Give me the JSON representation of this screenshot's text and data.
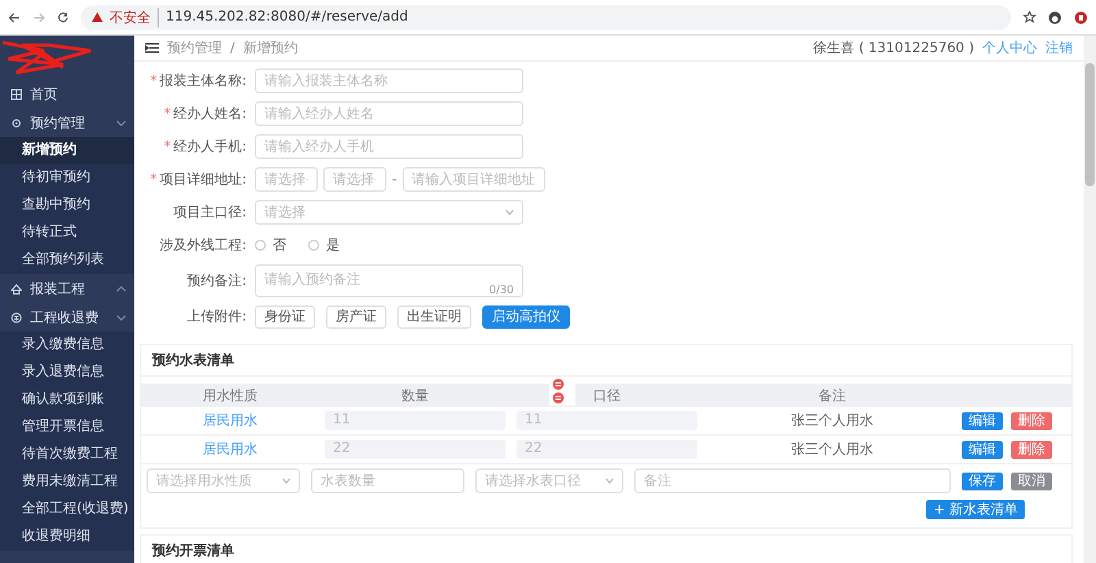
{
  "browser": {
    "warning": "不安全",
    "url": "119.45.202.82:8080/#/reserve/add"
  },
  "sidebar": {
    "items": [
      {
        "label": "首页",
        "selected": false
      },
      {
        "label": "预约管理",
        "expanded": true,
        "selected": false,
        "children": [
          {
            "label": "新增预约",
            "selected": true
          },
          {
            "label": "待初审预约",
            "selected": false
          },
          {
            "label": "查勘中预约",
            "selected": false
          },
          {
            "label": "待转正式",
            "selected": false
          },
          {
            "label": "全部预约列表",
            "selected": false
          }
        ]
      },
      {
        "label": "报装工程",
        "expanded": false,
        "selected": false
      },
      {
        "label": "工程收退费",
        "expanded": true,
        "selected": false,
        "children": [
          {
            "label": "录入缴费信息",
            "selected": false
          },
          {
            "label": "录入退费信息",
            "selected": false
          },
          {
            "label": "确认款项到账",
            "selected": false
          },
          {
            "label": "管理开票信息",
            "selected": false
          },
          {
            "label": "待首次缴费工程",
            "selected": false
          },
          {
            "label": "费用未缴清工程",
            "selected": false
          },
          {
            "label": "全部工程(收退费)",
            "selected": false
          },
          {
            "label": "收退费明细",
            "selected": false
          }
        ]
      }
    ]
  },
  "header": {
    "breadcrumb": [
      "预约管理",
      "新增预约"
    ],
    "breadcrumb_separator": "/",
    "user": "徐生喜 ( 13101225760 )",
    "links": [
      "个人中心",
      "注销"
    ]
  },
  "form": {
    "fields": [
      {
        "kind": "text",
        "mark": "*",
        "label": "报装主体名称:",
        "placeholder": "请输入报装主体名称"
      },
      {
        "kind": "text",
        "mark": "*",
        "label": "经办人姓名:",
        "placeholder": "请输入经办人姓名"
      },
      {
        "kind": "text",
        "mark": "*",
        "label": "经办人手机:",
        "placeholder": "请输入经办人手机"
      },
      {
        "kind": "address",
        "mark": "*",
        "label": "项目详细地址:",
        "selects": [
          "请选择",
          "请选择"
        ],
        "separator": "-",
        "placeholder": "请输入项目详细地址"
      },
      {
        "kind": "select",
        "label": "项目主口径:",
        "placeholder": "请选择"
      },
      {
        "kind": "radio",
        "label": "涉及外线工程:",
        "options": [
          {
            "label": "否",
            "selected": false
          },
          {
            "label": "是",
            "selected": false
          }
        ]
      },
      {
        "kind": "textarea",
        "label": "预约备注:",
        "placeholder": "请输入预约备注",
        "counter": "0/30"
      },
      {
        "kind": "upload",
        "label": "上传附件:",
        "buttons": [
          {
            "label": "身份证",
            "primary": false
          },
          {
            "label": "房产证",
            "primary": false
          },
          {
            "label": "出生证明",
            "primary": false
          },
          {
            "label": "启动高拍仪",
            "primary": true
          }
        ]
      }
    ]
  },
  "meter_section": {
    "title": "预约水表清单",
    "columns": [
      "用水性质",
      "数量",
      "口径",
      "备注"
    ],
    "rows": [
      {
        "type": "居民用水",
        "count": "11",
        "caliber": "11",
        "note": "张三个人用水",
        "actions": [
          {
            "label": "编辑",
            "kind": "edit"
          },
          {
            "label": "删除",
            "kind": "delete"
          }
        ]
      },
      {
        "type": "居民用水",
        "count": "22",
        "caliber": "22",
        "note": "张三个人用水",
        "actions": [
          {
            "label": "编辑",
            "kind": "edit"
          },
          {
            "label": "删除",
            "kind": "delete"
          }
        ]
      }
    ],
    "new_row": {
      "placeholders": [
        "请选择用水性质",
        "水表数量",
        "请选择水表口径",
        "备注"
      ],
      "actions": [
        {
          "label": "保存",
          "kind": "edit"
        },
        {
          "label": "取消",
          "kind": "cancel"
        }
      ]
    },
    "add_button": "+ 新水表清单"
  },
  "invoice_section": {
    "title": "预约开票清单"
  }
}
